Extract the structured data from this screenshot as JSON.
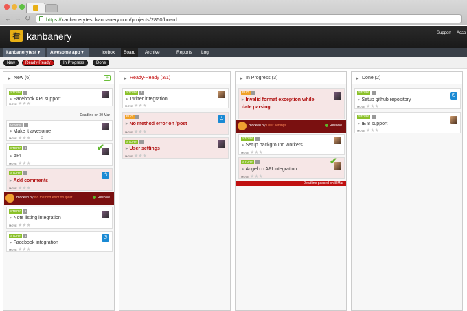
{
  "browser": {
    "url_secure": "https://",
    "url_rest": "kanbanerytest.kanbanery.com/projects/2850/board"
  },
  "header": {
    "brand": "kanbanery",
    "logo_glyph": "看",
    "links": [
      "Support",
      "Acco"
    ]
  },
  "menubar": {
    "workspace": "kanbanerytest ▾",
    "project": "Awesome app ▾",
    "items": [
      "Icebox",
      "Board",
      "Archive",
      "Reports",
      "Log"
    ],
    "active": "Board"
  },
  "filters": [
    "New",
    "Ready-Ready",
    "In Progress",
    "Done"
  ],
  "columns": [
    {
      "title": "New (6)",
      "color": "#333333"
    },
    {
      "title": "Ready-Ready (3/1)",
      "color": "#c00000"
    },
    {
      "title": "In Progress (3)",
      "color": "#333333"
    },
    {
      "title": "Done (2)",
      "color": "#333333"
    }
  ],
  "cards": {
    "c1": {
      "tag": "STORY",
      "title": "Facebook API support"
    },
    "c2": {
      "tag": "CHORE",
      "title": "Make it awesome",
      "deadline": "Deadline on 30 Mar",
      "comments": "3"
    },
    "c3": {
      "tag": "STORY",
      "estimate": "8",
      "title": "API"
    },
    "c4": {
      "tag": "STORY",
      "title": "Add comments"
    },
    "c5": {
      "tag": "STORY",
      "estimate": "5",
      "title": "Note listing integration"
    },
    "c6": {
      "tag": "STORY",
      "estimate": "1",
      "title": "Facebook integration"
    },
    "r1": {
      "tag": "STORY",
      "estimate": "3",
      "title": "Twitter integration"
    },
    "r2": {
      "tag": "BUG",
      "title": "No method error on /post"
    },
    "r3": {
      "tag": "STORY",
      "title": "User settings"
    },
    "p1": {
      "tag": "BUG",
      "title": "Invalid format exception while date parsing"
    },
    "p2": {
      "tag": "STORY",
      "title": "Setup background workers"
    },
    "p3": {
      "tag": "STORY",
      "title": "Angel.co API integration",
      "deadline": "Deadline passed on 8 Mar"
    },
    "d1": {
      "tag": "STORY",
      "title": "Setup github repository"
    },
    "d2": {
      "tag": "STORY",
      "title": "IE 8 support"
    }
  },
  "blocked": {
    "b1": {
      "prefix": "Blocked by ",
      "by": "No method error on /post",
      "resolve": "Resolve"
    },
    "b2": {
      "prefix": "Blocked by ",
      "by": "User settings",
      "resolve": "Resolve"
    }
  },
  "move_label": "MOVE",
  "tag_colors": {
    "story": "#8bc12a",
    "bug": "#f0a22a",
    "chore": "#aaaaaa"
  }
}
